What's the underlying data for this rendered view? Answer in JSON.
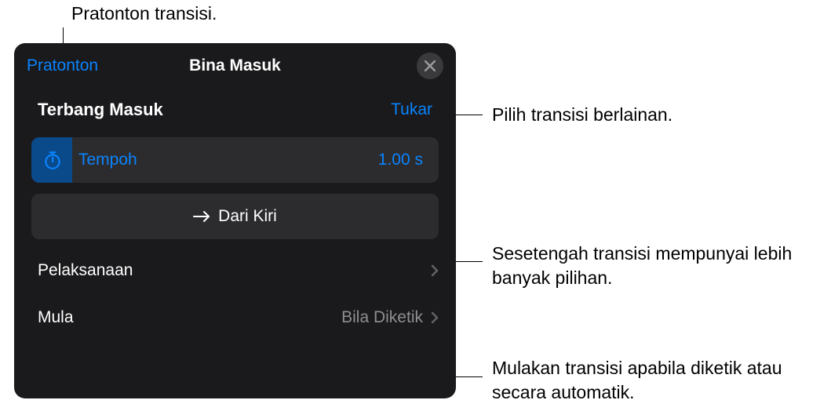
{
  "callouts": {
    "preview": "Pratonton transisi.",
    "change": "Pilih transisi berlainan.",
    "direction": "Sesetengah transisi mempunyai lebih banyak pilihan.",
    "start": "Mulakan transisi apabila diketik atau secara automatik."
  },
  "panel": {
    "preview_link": "Pratonton",
    "title": "Bina Masuk",
    "effect_name": "Terbang Masuk",
    "change_link": "Tukar",
    "duration": {
      "label": "Tempoh",
      "value": "1.00 s"
    },
    "direction": {
      "label": "Dari Kiri"
    },
    "delivery": {
      "label": "Pelaksanaan"
    },
    "start": {
      "label": "Mula",
      "value": "Bila Diketik"
    }
  }
}
